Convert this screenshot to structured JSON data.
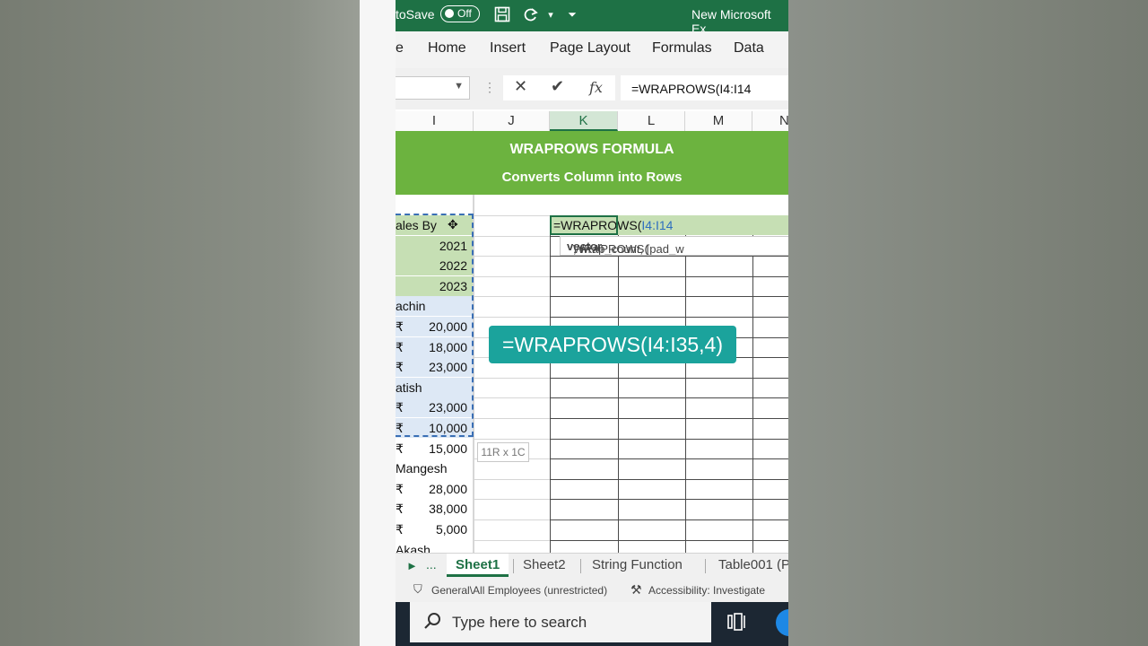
{
  "titlebar": {
    "autosave_label": "toSave",
    "toggle_state": "Off",
    "doc_title": "New Microsoft Ex"
  },
  "ribbon": {
    "tabs": [
      "e",
      "Home",
      "Insert",
      "Page Layout",
      "Formulas",
      "Data"
    ]
  },
  "formula_bar": {
    "name_box": "",
    "fx_label": "fx",
    "formula": "=WRAPROWS(I4:I14"
  },
  "columns": [
    "I",
    "J",
    "K",
    "L",
    "M",
    "N"
  ],
  "banner": {
    "title": "WRAPROWS FORMULA",
    "subtitle": "Converts Column into Rows"
  },
  "column_i": [
    {
      "text": "ales By",
      "type": "text",
      "style": "green"
    },
    {
      "text": "2021",
      "type": "num",
      "style": "green"
    },
    {
      "text": "2022",
      "type": "num",
      "style": "green"
    },
    {
      "text": "2023",
      "type": "num",
      "style": "green"
    },
    {
      "text": "achin",
      "type": "text",
      "style": "blue"
    },
    {
      "text": "20,000",
      "type": "money",
      "style": "blue"
    },
    {
      "text": "18,000",
      "type": "money",
      "style": "blue"
    },
    {
      "text": "23,000",
      "type": "money",
      "style": "blue"
    },
    {
      "text": "atish",
      "type": "text",
      "style": "blue"
    },
    {
      "text": "23,000",
      "type": "money",
      "style": "blue"
    },
    {
      "text": "10,000",
      "type": "money",
      "style": "blue"
    },
    {
      "text": "15,000",
      "type": "money",
      "style": "plain"
    },
    {
      "text": "Mangesh",
      "type": "text",
      "style": "plain"
    },
    {
      "text": "28,000",
      "type": "money",
      "style": "plain"
    },
    {
      "text": "38,000",
      "type": "money",
      "style": "plain"
    },
    {
      "text": "5,000",
      "type": "money",
      "style": "plain"
    },
    {
      "text": "Akash",
      "type": "text",
      "style": "plain"
    }
  ],
  "currency_symbol": "₹",
  "active_cell": {
    "prefix": "=WRAPROWS(",
    "ref": "I4:I14"
  },
  "tooltip": {
    "fn": "WRAPROWS(",
    "arg_bold": "vector",
    "rest": ", wrap_count, [pad_w"
  },
  "size_tip": "11R x 1C",
  "callout": "=WRAPROWS(I4:I35,4)",
  "sheet_tabs": {
    "dots": "...",
    "tabs": [
      "Sheet1",
      "Sheet2",
      "String Function",
      "Table001 (P"
    ]
  },
  "status": {
    "sensitivity": "General\\All Employees (unrestricted)",
    "accessibility": "Accessibility: Investigate"
  },
  "taskbar": {
    "search_placeholder": "Type here to search"
  },
  "colors": {
    "excel_green": "#1e7145",
    "banner_green": "#6cb33f",
    "callout_teal": "#1ba39c",
    "header_fill": "#c6dfb4",
    "selection_fill": "#dde8f5"
  }
}
